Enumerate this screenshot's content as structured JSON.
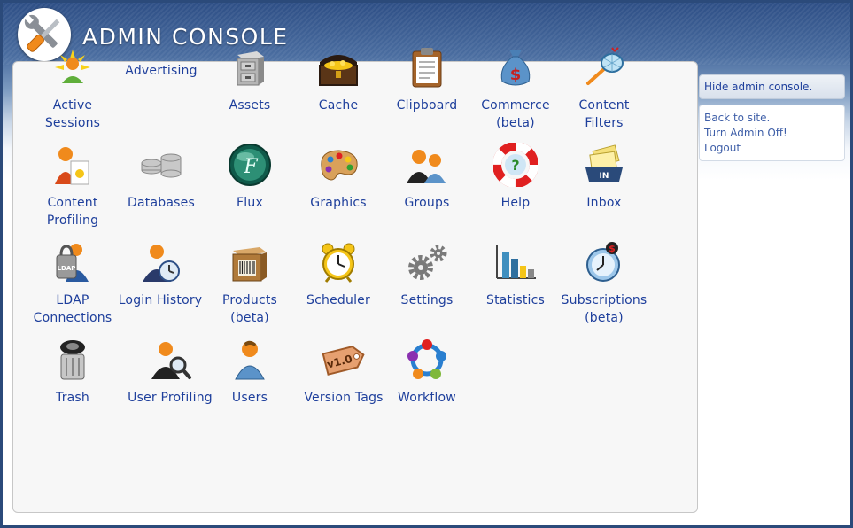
{
  "header": {
    "title": "ADMIN CONSOLE",
    "logo_icon": "wrench-screwdriver-icon"
  },
  "tools": [
    {
      "id": "active-sessions",
      "label": "Active Sessions",
      "lines": [
        "Active",
        "Sessions"
      ],
      "icon": "active-sessions-icon"
    },
    {
      "id": "advertising",
      "label": "Advertising",
      "lines": [
        "Advertising"
      ],
      "icon": null
    },
    {
      "id": "assets",
      "label": "Assets",
      "lines": [
        "Assets"
      ],
      "icon": "filing-cabinet-icon"
    },
    {
      "id": "cache",
      "label": "Cache",
      "lines": [
        "Cache"
      ],
      "icon": "treasure-chest-icon"
    },
    {
      "id": "clipboard",
      "label": "Clipboard",
      "lines": [
        "Clipboard"
      ],
      "icon": "clipboard-icon"
    },
    {
      "id": "commerce",
      "label": "Commerce (beta)",
      "lines": [
        "Commerce",
        "(beta)"
      ],
      "icon": "money-bag-icon"
    },
    {
      "id": "content-filters",
      "label": "Content Filters",
      "lines": [
        "Content",
        "Filters"
      ],
      "icon": "net-icon"
    },
    {
      "id": "content-profiling",
      "label": "Content Profiling",
      "lines": [
        "Content",
        "Profiling"
      ],
      "icon": "content-profiling-icon"
    },
    {
      "id": "databases",
      "label": "Databases",
      "lines": [
        "Databases"
      ],
      "icon": "database-icon"
    },
    {
      "id": "flux",
      "label": "Flux",
      "lines": [
        "Flux"
      ],
      "icon": "flux-icon"
    },
    {
      "id": "graphics",
      "label": "Graphics",
      "lines": [
        "Graphics"
      ],
      "icon": "paint-palette-icon"
    },
    {
      "id": "groups",
      "label": "Groups",
      "lines": [
        "Groups"
      ],
      "icon": "group-users-icon"
    },
    {
      "id": "help",
      "label": "Help",
      "lines": [
        "Help"
      ],
      "icon": "life-ring-icon"
    },
    {
      "id": "inbox",
      "label": "Inbox",
      "lines": [
        "Inbox"
      ],
      "icon": "inbox-tray-icon"
    },
    {
      "id": "ldap",
      "label": "LDAP Connections",
      "lines": [
        "LDAP",
        "Connections"
      ],
      "icon": "ldap-user-icon"
    },
    {
      "id": "login-history",
      "label": "Login History",
      "lines": [
        "Login History"
      ],
      "icon": "login-history-icon"
    },
    {
      "id": "products",
      "label": "Products (beta)",
      "lines": [
        "Products",
        "(beta)"
      ],
      "icon": "barcode-box-icon"
    },
    {
      "id": "scheduler",
      "label": "Scheduler",
      "lines": [
        "Scheduler"
      ],
      "icon": "alarm-clock-icon"
    },
    {
      "id": "settings",
      "label": "Settings",
      "lines": [
        "Settings"
      ],
      "icon": "gears-icon"
    },
    {
      "id": "statistics",
      "label": "Statistics",
      "lines": [
        "Statistics"
      ],
      "icon": "bar-chart-icon"
    },
    {
      "id": "subscriptions",
      "label": "Subscriptions (beta)",
      "lines": [
        "Subscriptions",
        "(beta)"
      ],
      "icon": "subscription-clock-icon"
    },
    {
      "id": "trash",
      "label": "Trash",
      "lines": [
        "Trash"
      ],
      "icon": "trash-can-icon"
    },
    {
      "id": "user-profiling",
      "label": "User Profiling",
      "lines": [
        "User Profiling"
      ],
      "icon": "user-magnifier-icon"
    },
    {
      "id": "users",
      "label": "Users",
      "lines": [
        "Users"
      ],
      "icon": "user-icon"
    },
    {
      "id": "version-tags",
      "label": "Version Tags",
      "lines": [
        "Version Tags"
      ],
      "icon": "version-tag-icon",
      "tag_text": "v1.0"
    },
    {
      "id": "workflow",
      "label": "Workflow",
      "lines": [
        "Workflow"
      ],
      "icon": "workflow-icon"
    }
  ],
  "sidebar": {
    "hide_label": "Hide admin console.",
    "links": [
      "Back to site.",
      "Turn Admin Off!",
      "Logout"
    ]
  },
  "colors": {
    "link": "#1e3f9c",
    "header": "#2e4f86",
    "panel": "#f7f7f7"
  }
}
